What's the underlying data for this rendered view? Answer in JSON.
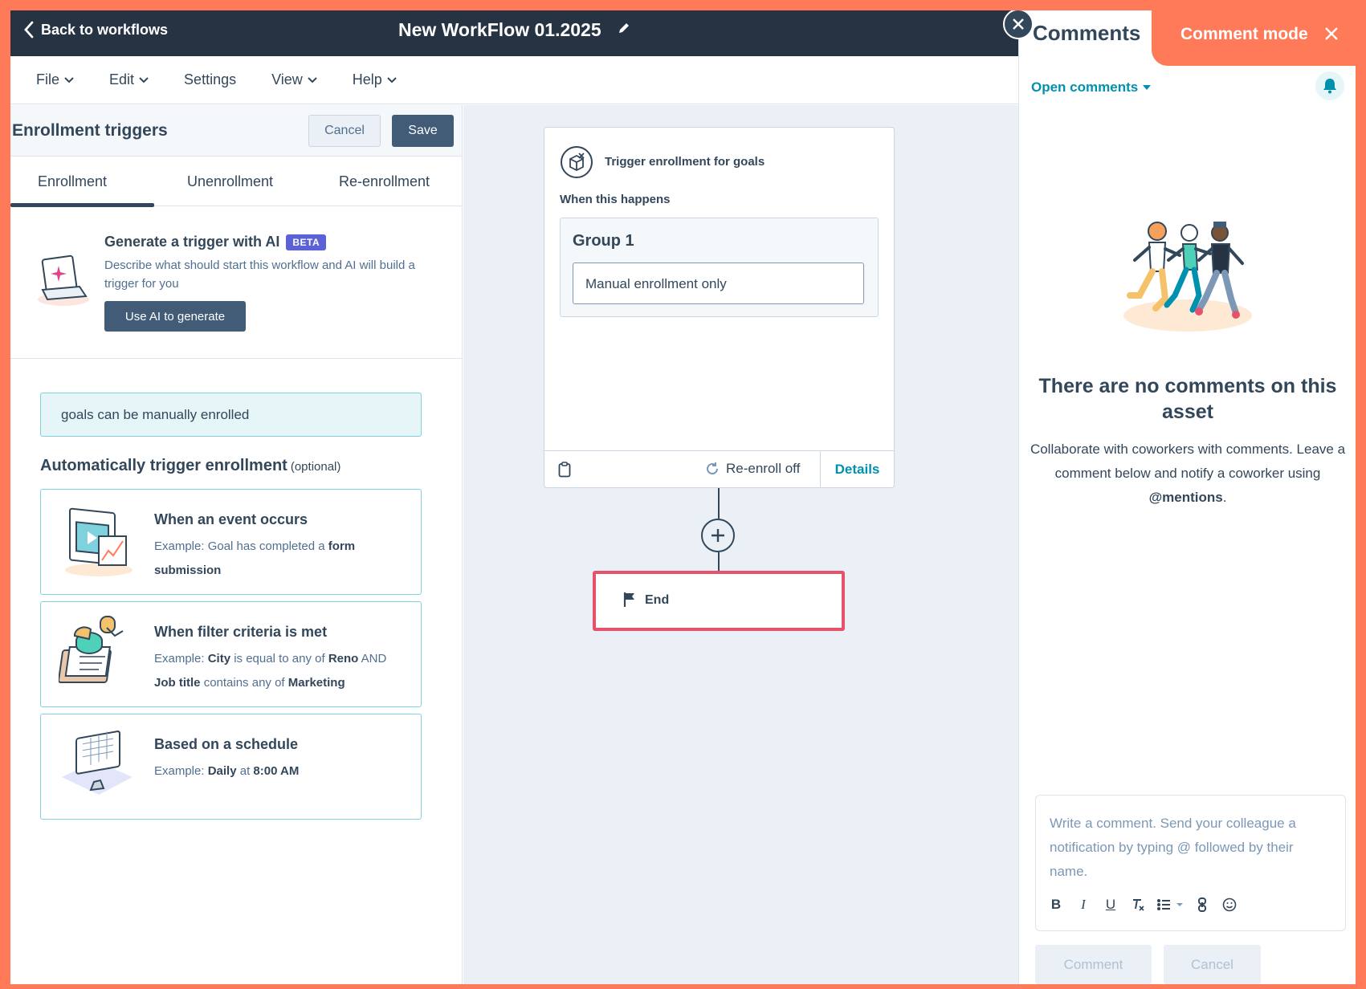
{
  "header": {
    "back_label": "Back to workflows",
    "workflow_title": "New WorkFlow 01.2025"
  },
  "menu": {
    "items": [
      "File",
      "Edit",
      "Settings",
      "View",
      "Help"
    ]
  },
  "left_panel": {
    "title": "Enrollment triggers",
    "cancel_label": "Cancel",
    "save_label": "Save",
    "tabs": [
      "Enrollment",
      "Unenrollment",
      "Re-enrollment"
    ],
    "active_tab": "Enrollment",
    "ai": {
      "title": "Generate a trigger with AI",
      "badge": "BETA",
      "description": "Describe what should start this workflow and AI will build a trigger for you",
      "button": "Use AI to generate"
    },
    "manual_note": "goals can be manually enrolled",
    "auto_title": "Automatically trigger enrollment",
    "auto_optional": "(optional)",
    "cards": [
      {
        "title": "When an event occurs",
        "example_prefix": "Example:",
        "example_parts": [
          "Goal has completed a",
          "form submission"
        ]
      },
      {
        "title": "When filter criteria is met",
        "example_prefix": "Example:",
        "example_parts": [
          "City",
          "is equal to any of",
          "Reno",
          "AND",
          "Job title",
          "contains any of",
          "Marketing"
        ]
      },
      {
        "title": "Based on a schedule",
        "example_prefix": "Example:",
        "example_parts": [
          "Daily",
          "at",
          "8:00 AM"
        ]
      }
    ]
  },
  "canvas": {
    "enroll_card": {
      "title": "Trigger enrollment for goals",
      "when_label": "When this happens",
      "group_title": "Group 1",
      "group_filter": "Manual enrollment only",
      "reenroll": "Re-enroll off",
      "details": "Details"
    },
    "end_label": "End"
  },
  "comments": {
    "title": "Comments",
    "mode_label": "Comment mode",
    "filter_label": "Open comments",
    "empty_title": "There are no comments on this asset",
    "empty_desc_1": "Collaborate with coworkers with comments. Leave a comment below and notify a coworker using",
    "empty_desc_mention": "@mentions",
    "empty_desc_end": ".",
    "placeholder": "Write a comment. Send your colleague a notification by typing @ followed by their name.",
    "comment_button": "Comment",
    "cancel_button": "Cancel"
  },
  "colors": {
    "accent": "#ff7a59",
    "header_bg": "#253342",
    "teal": "#0091ae",
    "end_border": "#e6526a"
  }
}
